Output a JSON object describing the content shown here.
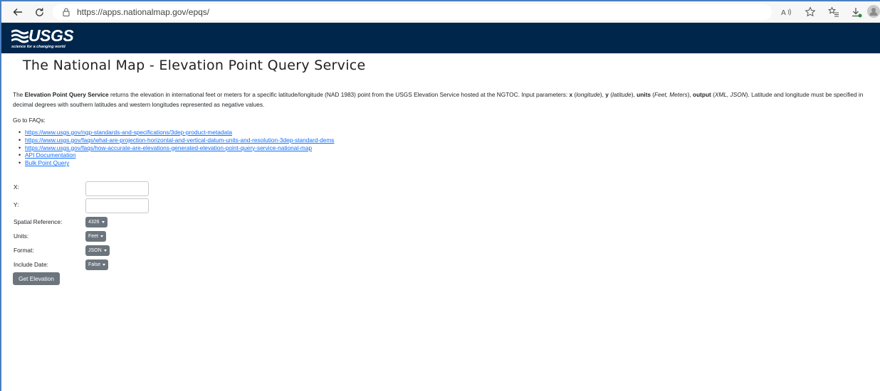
{
  "browser": {
    "url": "https://apps.nationalmap.gov/epqs/"
  },
  "header": {
    "logo_text": "USGS",
    "tagline": "science for a changing world",
    "background": "#00264c"
  },
  "page": {
    "title": "The National Map - Elevation Point Query Service",
    "description": {
      "t1": "The ",
      "b1": "Elevation Point Query Service",
      "t2": " returns the elevation in international feet or meters for a specific latitude/longitude (NAD 1983) point from the USGS Elevation Service hosted at the NGTOC. Input parameters: ",
      "b2": "x",
      "t3": " (",
      "i1": "longitude",
      "t4": "), ",
      "b3": "y",
      "t5": " (",
      "i2": "latitude",
      "t6": "), ",
      "b4": "units",
      "t7": " (",
      "i3": "Feet, Meters",
      "t8": "), ",
      "b5": "output",
      "t9": " (",
      "i4": "XML, JSON",
      "t10": "). Latitude and longitude must be specified in decimal degrees with southern latitudes and western longitudes represented as negative values."
    },
    "faq_label": "Go to FAQs:",
    "links": [
      "https://www.usgs.gov/ngp-standards-and-specifications/3dep-product-metadata",
      "https://www.usgs.gov/faqs/what-are-projection-horizontal-and-vertical-datum-units-and-resolution-3dep-standard-dems",
      "https://www.usgs.gov/faqs/how-accurate-are-elevations-generated-elevation-point-query-service-national-map",
      "API Documentation",
      "Bulk Point Query"
    ]
  },
  "form": {
    "x_label": "X:",
    "x_value": "",
    "y_label": "Y:",
    "y_value": "",
    "spatial_ref_label": "Spatial Reference:",
    "spatial_ref_value": "4326",
    "units_label": "Units:",
    "units_value": "Feet",
    "format_label": "Format:",
    "format_value": "JSON",
    "include_date_label": "Include Date:",
    "include_date_value": "False",
    "submit_label": "Get Elevation"
  }
}
